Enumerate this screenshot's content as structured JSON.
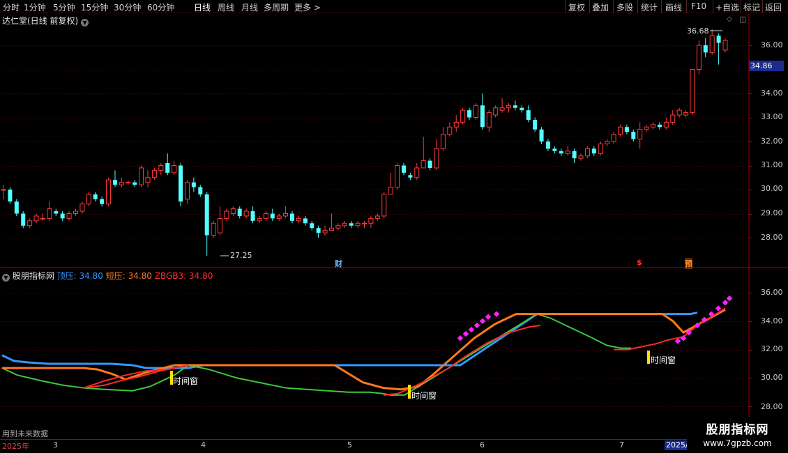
{
  "toolbar": {
    "left": [
      "分时",
      "1分钟",
      "5分钟",
      "15分钟",
      "30分钟",
      "60分钟",
      "日线",
      "周线",
      "月线",
      "多周期",
      "更多 >"
    ],
    "active_index": 6,
    "right": [
      "复权",
      "叠加",
      "多股",
      "统计",
      "画线",
      "F10",
      "+自选",
      "返回"
    ]
  },
  "main_title": "达仁堂(日线 前复权)",
  "indicator": {
    "name": "股朋指标网",
    "lines": [
      {
        "label": "顶压: 34.80",
        "color": "#3399ff"
      },
      {
        "label": "短压: 34.80",
        "color": "#ff7a1a"
      },
      {
        "label": "ZBGB3: 34.80",
        "color": "#ff3030"
      }
    ]
  },
  "price_axis": [
    "36.00",
    "35.00",
    "34.00",
    "33.00",
    "32.00",
    "31.00",
    "30.00",
    "29.00",
    "28.00"
  ],
  "current_price": "34.86",
  "annotations": {
    "high": "36.68",
    "low": "27.25"
  },
  "indicator_axis": [
    "36.00",
    "34.00",
    "32.00",
    "30.00",
    "28.00"
  ],
  "markers": [
    {
      "text": "财",
      "color": "#6ab0ff"
    },
    {
      "text": "$",
      "color": "#ff3333"
    },
    {
      "text": "预",
      "color": "#ff8c2a"
    }
  ],
  "window_labels": [
    "时间窗",
    "时间窗",
    "时间窗"
  ],
  "future_note": "用到未来数据",
  "date_axis": [
    "2025年",
    "3",
    "4",
    "5",
    "6",
    "7"
  ],
  "date_box": "2025/",
  "watermark": {
    "title": "股朋指标网",
    "url": "www.7gpzb.com"
  },
  "colors": {
    "up": "#ff3b3b",
    "down": "#54ffff",
    "grid": "#6e0000",
    "border": "#aa0000",
    "top_line": "#3399ff",
    "short_line": "#ff7a1a",
    "zbgb3_line": "#ff2a2a",
    "green_line": "#3cc83c",
    "dots": "#ff22ff",
    "window_bar": "#ffe000"
  },
  "chart_data": {
    "type": "candlestick",
    "candles": [
      [
        30.0,
        30.0,
        30.2,
        29.6
      ],
      [
        30.0,
        29.5,
        30.1,
        29.4
      ],
      [
        29.5,
        29.0,
        29.6,
        28.9
      ],
      [
        29.0,
        28.5,
        29.1,
        28.4
      ],
      [
        28.5,
        28.7,
        28.8,
        28.4
      ],
      [
        28.7,
        28.9,
        29.0,
        28.6
      ],
      [
        28.8,
        28.8,
        29.0,
        28.7
      ],
      [
        28.8,
        29.2,
        29.5,
        28.7
      ],
      [
        29.1,
        29.0,
        29.2,
        28.9
      ],
      [
        29.0,
        28.8,
        29.1,
        28.7
      ],
      [
        28.8,
        29.0,
        29.1,
        28.7
      ],
      [
        29.0,
        29.1,
        29.2,
        28.9
      ],
      [
        29.1,
        29.4,
        29.5,
        29.0
      ],
      [
        29.4,
        29.8,
        29.9,
        29.3
      ],
      [
        29.8,
        29.6,
        29.9,
        29.5
      ],
      [
        29.6,
        29.4,
        29.7,
        29.3
      ],
      [
        29.4,
        30.4,
        30.5,
        29.3
      ],
      [
        30.4,
        30.2,
        30.8,
        30.1
      ],
      [
        30.2,
        30.3,
        30.5,
        30.1
      ],
      [
        30.3,
        30.3,
        30.4,
        30.2
      ],
      [
        30.3,
        30.2,
        30.4,
        30.1
      ],
      [
        30.2,
        30.9,
        31.0,
        30.1
      ],
      [
        30.3,
        30.5,
        30.8,
        30.1
      ],
      [
        30.5,
        30.8,
        30.9,
        30.4
      ],
      [
        30.8,
        31.0,
        31.1,
        30.6
      ],
      [
        31.1,
        30.7,
        31.5,
        30.6
      ],
      [
        30.7,
        31.0,
        31.2,
        30.6
      ],
      [
        31.0,
        29.5,
        31.1,
        29.3
      ],
      [
        29.6,
        30.3,
        30.4,
        29.4
      ],
      [
        30.3,
        30.1,
        30.5,
        29.9
      ],
      [
        30.1,
        29.8,
        30.2,
        29.7
      ],
      [
        29.8,
        28.1,
        29.9,
        27.25
      ],
      [
        28.1,
        28.6,
        28.7,
        28.0
      ],
      [
        28.2,
        28.8,
        29.3,
        28.1
      ],
      [
        28.8,
        29.1,
        29.2,
        28.7
      ],
      [
        29.0,
        29.2,
        29.3,
        28.9
      ],
      [
        29.2,
        28.9,
        29.3,
        28.8
      ],
      [
        28.9,
        29.1,
        29.2,
        28.8
      ],
      [
        29.1,
        28.7,
        29.3,
        28.6
      ],
      [
        28.7,
        28.8,
        28.9,
        28.6
      ],
      [
        28.8,
        29.0,
        29.1,
        28.7
      ],
      [
        29.0,
        28.8,
        29.2,
        28.7
      ],
      [
        28.8,
        28.9,
        29.0,
        28.7
      ],
      [
        28.9,
        29.0,
        29.3,
        28.8
      ],
      [
        29.0,
        28.7,
        29.1,
        28.6
      ],
      [
        28.7,
        28.8,
        28.9,
        28.6
      ],
      [
        28.8,
        28.6,
        28.9,
        28.5
      ],
      [
        28.6,
        28.4,
        28.7,
        28.3
      ],
      [
        28.4,
        28.2,
        28.5,
        28.0
      ],
      [
        28.2,
        28.3,
        28.5,
        28.1
      ],
      [
        28.3,
        28.4,
        29.0,
        28.3
      ],
      [
        28.4,
        28.5,
        28.6,
        28.3
      ],
      [
        28.5,
        28.6,
        28.7,
        28.4
      ],
      [
        28.6,
        28.5,
        28.7,
        28.4
      ],
      [
        28.5,
        28.6,
        28.7,
        28.4
      ],
      [
        28.6,
        28.6,
        28.7,
        28.4
      ],
      [
        28.6,
        28.8,
        28.9,
        28.4
      ],
      [
        28.8,
        28.9,
        29.0,
        28.7
      ],
      [
        28.9,
        29.8,
        29.9,
        28.8
      ],
      [
        29.8,
        30.1,
        30.7,
        29.9
      ],
      [
        30.1,
        31.0,
        31.1,
        30.0
      ],
      [
        31.0,
        30.7,
        31.1,
        30.6
      ],
      [
        30.6,
        30.5,
        30.7,
        30.4
      ],
      [
        30.5,
        30.9,
        31.1,
        30.4
      ],
      [
        30.9,
        31.2,
        32.2,
        30.9
      ],
      [
        31.2,
        30.9,
        31.3,
        30.8
      ],
      [
        30.9,
        31.7,
        32.1,
        30.8
      ],
      [
        31.7,
        32.3,
        32.6,
        31.6
      ],
      [
        32.3,
        32.6,
        32.8,
        32.2
      ],
      [
        32.6,
        32.8,
        33.1,
        32.4
      ],
      [
        32.8,
        33.3,
        33.4,
        32.7
      ],
      [
        33.3,
        33.0,
        33.4,
        32.9
      ],
      [
        33.0,
        33.5,
        33.6,
        32.9
      ],
      [
        33.5,
        32.6,
        34.0,
        32.5
      ],
      [
        32.6,
        33.2,
        33.3,
        32.4
      ],
      [
        33.1,
        33.4,
        33.5,
        33.0
      ],
      [
        33.3,
        33.4,
        33.8,
        33.2
      ],
      [
        33.4,
        33.5,
        33.6,
        33.2
      ],
      [
        33.5,
        33.4,
        33.7,
        33.3
      ],
      [
        33.4,
        33.3,
        33.5,
        33.2
      ],
      [
        33.3,
        32.9,
        33.5,
        32.8
      ],
      [
        32.9,
        32.5,
        33.0,
        32.4
      ],
      [
        32.5,
        32.0,
        32.6,
        31.9
      ],
      [
        32.0,
        31.7,
        32.1,
        31.6
      ],
      [
        31.7,
        31.6,
        31.8,
        31.5
      ],
      [
        31.6,
        31.5,
        31.7,
        31.4
      ],
      [
        31.5,
        31.6,
        31.8,
        31.4
      ],
      [
        31.6,
        31.3,
        31.7,
        31.1
      ],
      [
        31.3,
        31.4,
        31.5,
        31.2
      ],
      [
        31.4,
        31.7,
        31.8,
        31.3
      ],
      [
        31.7,
        31.5,
        31.8,
        31.4
      ],
      [
        31.5,
        31.9,
        32.0,
        31.4
      ],
      [
        31.9,
        32.0,
        32.1,
        31.8
      ],
      [
        32.0,
        32.3,
        32.4,
        31.9
      ],
      [
        32.3,
        32.6,
        32.7,
        32.2
      ],
      [
        32.6,
        32.4,
        32.7,
        32.3
      ],
      [
        32.4,
        32.1,
        32.5,
        32.0
      ],
      [
        32.1,
        32.5,
        32.8,
        31.7
      ],
      [
        32.5,
        32.6,
        32.7,
        32.4
      ],
      [
        32.6,
        32.7,
        32.8,
        32.5
      ],
      [
        32.7,
        32.6,
        32.8,
        32.5
      ],
      [
        32.6,
        32.8,
        33.0,
        32.5
      ],
      [
        32.8,
        33.1,
        33.3,
        32.7
      ],
      [
        33.1,
        33.3,
        33.4,
        33.0
      ],
      [
        33.1,
        33.2,
        33.3,
        33.0
      ],
      [
        33.2,
        35.0,
        35.0,
        33.1
      ],
      [
        35.0,
        36.0,
        36.2,
        34.8
      ],
      [
        36.0,
        35.7,
        36.3,
        35.5
      ],
      [
        35.7,
        36.4,
        36.68,
        35.6
      ],
      [
        36.4,
        36.1,
        36.5,
        35.2
      ],
      [
        35.8,
        36.2,
        36.3,
        35.7
      ]
    ],
    "indicator_series": {
      "top_line": [
        31.6,
        31.2,
        31.1,
        31.0,
        31.0,
        31.0,
        31.0,
        30.9,
        30.7,
        30.7,
        30.7,
        30.7,
        30.9,
        30.9,
        30.9,
        30.9,
        30.9,
        30.9,
        30.9,
        30.9,
        30.9,
        30.9,
        30.9,
        30.9,
        30.9,
        30.9,
        34.5,
        34.5,
        34.5,
        34.5,
        34.5,
        34.5,
        34.6
      ],
      "short_line": [
        30.7,
        30.7,
        30.7,
        30.7,
        30.7,
        30.6,
        30.3,
        29.9,
        30.4,
        30.9,
        30.9,
        30.9,
        30.9,
        30.9,
        30.9,
        30.9,
        30.3,
        29.7,
        29.3,
        29.2,
        29.4,
        30.2,
        31.5,
        32.8,
        33.8,
        34.5,
        34.5,
        34.5,
        34.5,
        34.5,
        34.5,
        34.0,
        33.2,
        34.8
      ],
      "zbgb3_line": [
        29.3,
        29.8,
        30.2,
        30.5,
        30.6,
        30.8,
        29.6,
        29.2,
        29.0,
        29.0,
        29.5,
        30.2,
        31.2,
        32.5,
        33.6,
        34.4,
        34.6,
        34.4,
        34.0,
        33.6,
        33.3,
        32.6,
        32.3,
        32.3,
        32.5,
        32.8,
        33.1,
        33.5,
        34.2,
        34.8
      ],
      "green_line": [
        30.7,
        30.2,
        29.8,
        29.5,
        29.3,
        29.2,
        29.1,
        29.4,
        30.2,
        30.9,
        30.6,
        30.0,
        29.6,
        29.3,
        29.2,
        29.1,
        29.0,
        29.0,
        28.9,
        28.8,
        28.8,
        34.5,
        34.2,
        33.5,
        32.8,
        32.3,
        32.1,
        32.1
      ],
      "dots": [
        32.8,
        33.1,
        33.4,
        33.7,
        34.0,
        34.3,
        34.5,
        32.6,
        32.8,
        33.2,
        33.7,
        34.1,
        34.5,
        34.9,
        35.3,
        35.6
      ]
    },
    "ylim_main": [
      27.5,
      37.0
    ],
    "ylim_indicator": [
      27.7,
      37.0
    ]
  }
}
